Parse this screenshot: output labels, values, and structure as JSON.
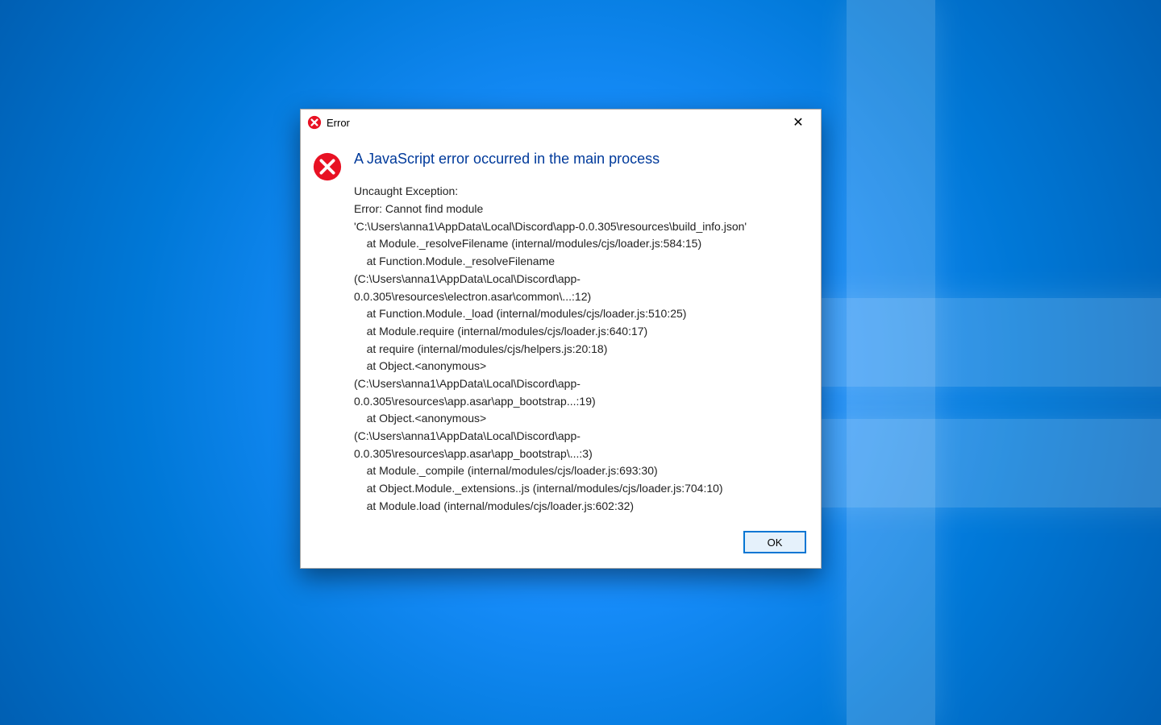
{
  "dialog": {
    "title": "Error",
    "close_glyph": "✕",
    "heading": "A JavaScript error occurred in the main process",
    "body_lines": [
      "Uncaught Exception:",
      "Error: Cannot find module",
      "'C:\\Users\\anna1\\AppData\\Local\\Discord\\app-0.0.305\\resources\\build_info.json'",
      "    at Module._resolveFilename (internal/modules/cjs/loader.js:584:15)",
      "    at Function.Module._resolveFilename",
      "(C:\\Users\\anna1\\AppData\\Local\\Discord\\app-0.0.305\\resources\\electron.asar\\common\\...:12)",
      "    at Function.Module._load (internal/modules/cjs/loader.js:510:25)",
      "    at Module.require (internal/modules/cjs/loader.js:640:17)",
      "    at require (internal/modules/cjs/helpers.js:20:18)",
      "    at Object.<anonymous>",
      "(C:\\Users\\anna1\\AppData\\Local\\Discord\\app-0.0.305\\resources\\app.asar\\app_bootstrap...:19)",
      "    at Object.<anonymous>",
      "(C:\\Users\\anna1\\AppData\\Local\\Discord\\app-0.0.305\\resources\\app.asar\\app_bootstrap\\...:3)",
      "    at Module._compile (internal/modules/cjs/loader.js:693:30)",
      "    at Object.Module._extensions..js (internal/modules/cjs/loader.js:704:10)",
      "    at Module.load (internal/modules/cjs/loader.js:602:32)"
    ],
    "ok_label": "OK"
  }
}
